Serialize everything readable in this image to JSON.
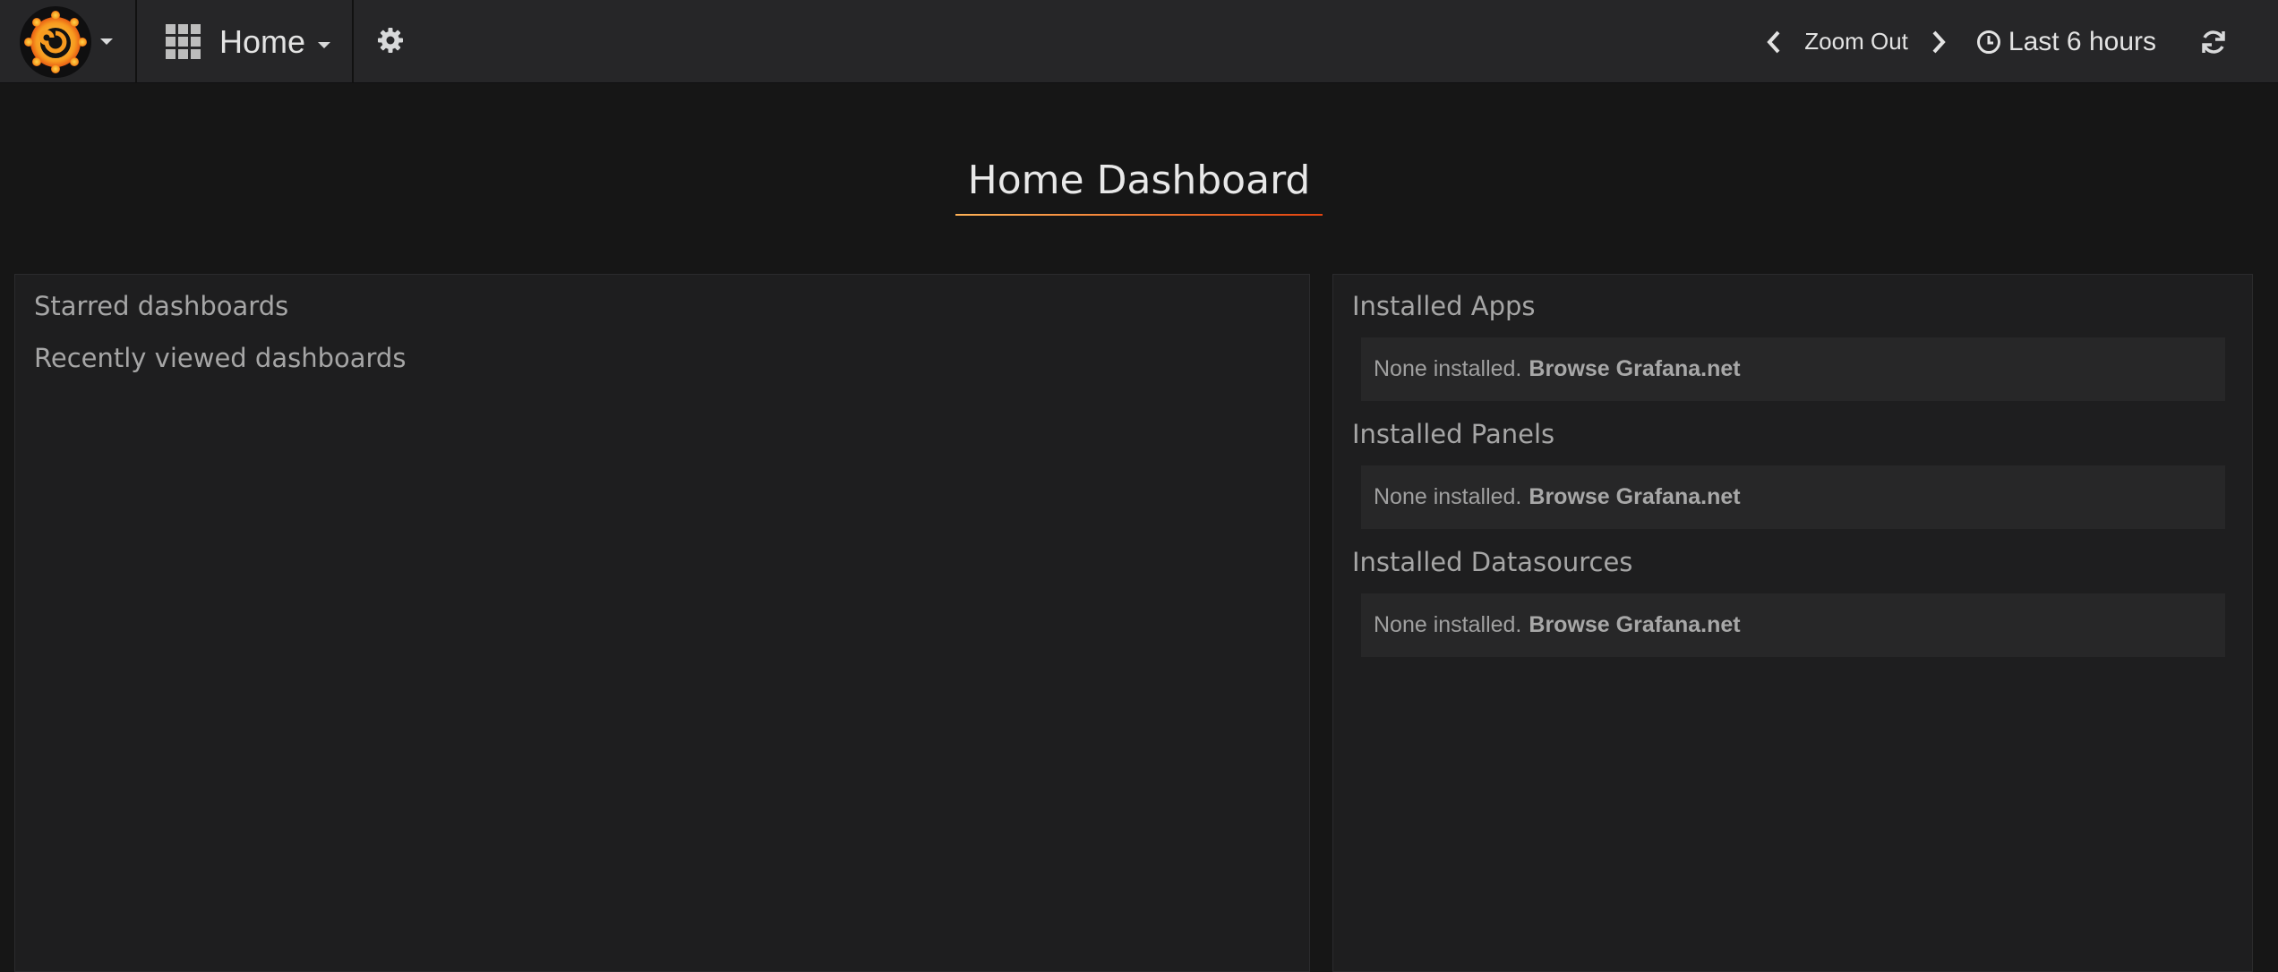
{
  "navbar": {
    "logo_icon": "grafana-logo-icon",
    "home_label": "Home",
    "zoom_label": "Zoom Out",
    "time_range": "Last 6 hours"
  },
  "title": "Home Dashboard",
  "left_panel": {
    "starred": "Starred dashboards",
    "recent": "Recently viewed dashboards"
  },
  "plugins": {
    "apps": {
      "heading": "Installed Apps",
      "empty_text": "None installed.",
      "link": "Browse Grafana.net"
    },
    "panels": {
      "heading": "Installed Panels",
      "empty_text": "None installed.",
      "link": "Browse Grafana.net"
    },
    "datasources": {
      "heading": "Installed Datasources",
      "empty_text": "None installed.",
      "link": "Browse Grafana.net"
    }
  },
  "colors": {
    "background": "#161616",
    "navbar": "#262628",
    "panel": "#1e1e1f",
    "accent_start": "#ffb357",
    "accent_end": "#e2430f"
  }
}
